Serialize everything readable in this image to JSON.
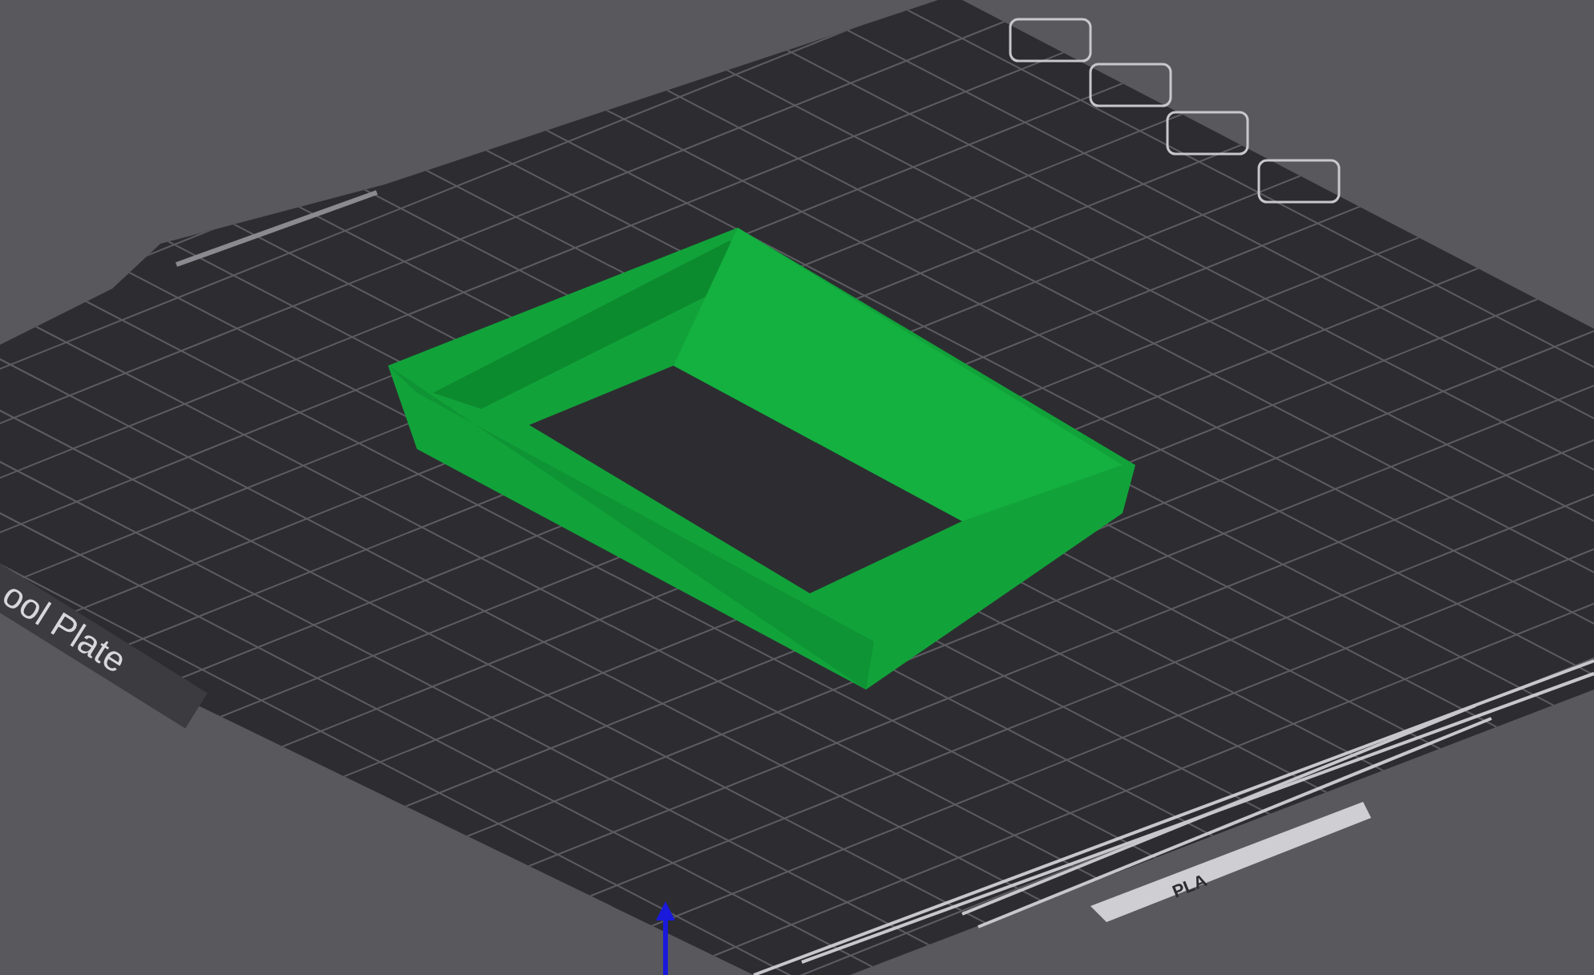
{
  "viewport": {
    "plate_label": "ool Plate",
    "filament_label": "PLA"
  }
}
